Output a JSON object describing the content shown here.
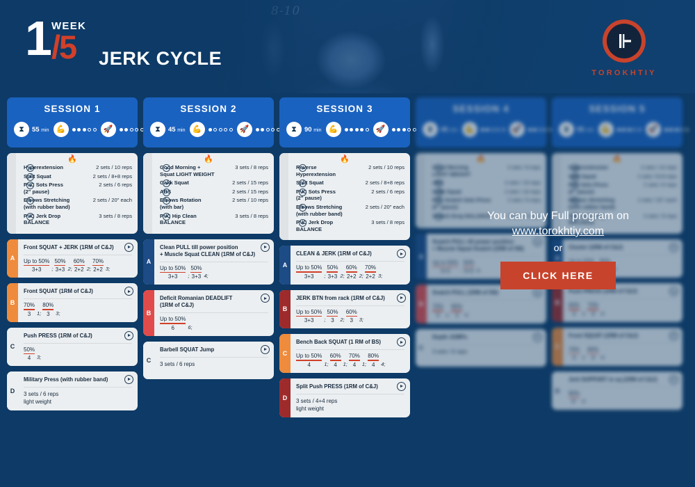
{
  "header": {
    "week_number": "1",
    "week_word": "WEEK",
    "week_fraction": "/5",
    "program_title": "JERK CYCLE",
    "chalk_text": "8-10",
    "brand_name": "TOROKHTIY",
    "logo_icon": "torokhtiy-barbell-logo"
  },
  "cta": {
    "line1": "You can buy Full program on",
    "link": "www.torokhtiy.com",
    "or": "or",
    "button": "CLICK HERE",
    "accent": "#c8432c"
  },
  "colors": {
    "background": "#0d3a66",
    "session_header": "#1a62c0",
    "card": "#eceff1",
    "accent_red": "#d1402a",
    "letter_orange": "#ef8b3c",
    "letter_red": "#e24b4b",
    "letter_darkred": "#9e2b2b",
    "letter_navy": "#1c4b86"
  },
  "icons": {
    "time": "hourglass-icon",
    "intensity": "muscle-arm-icon",
    "effort": "rocket-icon",
    "flame": "flame-icon",
    "play": "play-icon"
  },
  "sessions": [
    {
      "title": "SESSION 1",
      "locked": false,
      "duration": "55",
      "duration_unit": "min",
      "intensity": 3,
      "intensity_max": 5,
      "effort": 2,
      "effort_max": 5,
      "warmup": [
        {
          "name": "Hyperextension",
          "volume": "2 sets / 10 reps"
        },
        {
          "name": "Split Squat",
          "volume": "2 sets / 8+8 reps"
        },
        {
          "name": "PVC Sots Press\n(2\" pause)",
          "volume": "2 sets / 6 reps"
        },
        {
          "name": "Elbows Stretching\n(with rubber band)",
          "volume": "2 sets / 20\" each"
        },
        {
          "name": "PVC Jerk Drop\nBALANCE",
          "volume": "3 sets / 8 reps"
        }
      ],
      "blocks": [
        {
          "letter": "A",
          "letter_color": "orange",
          "title": "Front SQUAT + JERK (1RM of C&J)",
          "sets": [
            {
              "top": "Up to 50%",
              "bot": "3+3",
              "mult": ";"
            },
            {
              "top": "50%",
              "bot": "3+3",
              "mult": "2;"
            },
            {
              "top": "60%",
              "bot": "2+2",
              "mult": "2;"
            },
            {
              "top": "70%",
              "bot": "2+2",
              "mult": "3;"
            }
          ]
        },
        {
          "letter": "B",
          "letter_color": "orange",
          "title": "Front SQUAT (1RM of C&J)",
          "sets": [
            {
              "top": "70%",
              "bot": "3",
              "mult": "1;"
            },
            {
              "top": "80%",
              "bot": "3",
              "mult": "3;"
            }
          ]
        },
        {
          "letter": "C",
          "letter_color": "plain",
          "title": "Push PRESS (1RM of C&J)",
          "sets": [
            {
              "top": "50%",
              "bot": "4",
              "mult": "3;"
            }
          ]
        },
        {
          "letter": "D",
          "letter_color": "plain",
          "title": "Military Press (with rubber band)",
          "text": "3 sets / 6 reps\nlight weight"
        }
      ]
    },
    {
      "title": "SESSION 2",
      "locked": false,
      "duration": "45",
      "duration_unit": "min",
      "intensity": 1,
      "intensity_max": 5,
      "effort": 2,
      "effort_max": 5,
      "warmup": [
        {
          "name": "Good Morning +\nSquat LIGHT WEIGHT",
          "volume": "3 sets / 8 reps"
        },
        {
          "name": "Gakk Squat",
          "volume": "2 sets / 15 reps"
        },
        {
          "name": "ABS",
          "volume": "2 sets / 15 reps"
        },
        {
          "name": "Elbows Rotation\n(with bar)",
          "volume": "2 sets / 10 reps"
        },
        {
          "name": "PVC Hip Clean\nBALANCE",
          "volume": "3 sets / 8 reps"
        }
      ],
      "blocks": [
        {
          "letter": "A",
          "letter_color": "navy",
          "title": "Clean PULL till power position\n+ Muscle Squat CLEAN (1RM of C&J)",
          "sets": [
            {
              "top": "Up to 50%",
              "bot": "3+3",
              "mult": ";"
            },
            {
              "top": "50%",
              "bot": "3+3",
              "mult": "4;"
            }
          ]
        },
        {
          "letter": "B",
          "letter_color": "red",
          "title": "Deficit Romanian DEADLIFT\n(1RM of C&J)",
          "sets": [
            {
              "top": "Up to 50%",
              "bot": "6",
              "mult": "6;"
            }
          ]
        },
        {
          "letter": "C",
          "letter_color": "plain",
          "title": "Barbell SQUAT Jump",
          "text": "3 sets / 6 reps"
        }
      ]
    },
    {
      "title": "SESSION 3",
      "locked": false,
      "duration": "90",
      "duration_unit": "min",
      "intensity": 4,
      "intensity_max": 5,
      "effort": 3,
      "effort_max": 5,
      "warmup": [
        {
          "name": "Reverse\nHyperextension",
          "volume": "2 sets / 10 reps"
        },
        {
          "name": "Split Squat",
          "volume": "2 sets / 8+8 reps"
        },
        {
          "name": "PVC Sots Press\n(2\" pause)",
          "volume": "2 sets / 6 reps"
        },
        {
          "name": "Elbows Stretching\n(with rubber band)",
          "volume": "2 sets / 20\" each"
        },
        {
          "name": "PVC Jerk Drop\nBALANCE",
          "volume": "3 sets / 8 reps"
        }
      ],
      "blocks": [
        {
          "letter": "A",
          "letter_color": "navy",
          "title": "CLEAN & JERK (1RM of C&J)",
          "sets": [
            {
              "top": "Up to 50%",
              "bot": "3+3",
              "mult": ";"
            },
            {
              "top": "50%",
              "bot": "3+3",
              "mult": "2;"
            },
            {
              "top": "60%",
              "bot": "2+2",
              "mult": "2;"
            },
            {
              "top": "70%",
              "bot": "2+2",
              "mult": "3;"
            }
          ]
        },
        {
          "letter": "B",
          "letter_color": "darkred",
          "title": "JERK BTN from rack (1RM of C&J)",
          "sets": [
            {
              "top": "Up to 50%",
              "bot": "3+3",
              "mult": ";"
            },
            {
              "top": "50%",
              "bot": "3",
              "mult": "2;"
            },
            {
              "top": "60%",
              "bot": "3",
              "mult": "3;"
            }
          ]
        },
        {
          "letter": "C",
          "letter_color": "orange",
          "title": "Bench Back SQUAT (1 RM of BS)",
          "sets": [
            {
              "top": "Up to 50%",
              "bot": "4",
              "mult": "1;"
            },
            {
              "top": "60%",
              "bot": "4",
              "mult": "1;"
            },
            {
              "top": "70%",
              "bot": "4",
              "mult": "1;"
            },
            {
              "top": "80%",
              "bot": "4",
              "mult": "4;"
            }
          ]
        },
        {
          "letter": "D",
          "letter_color": "darkred",
          "title": "Split Push PRESS (1RM of C&J)",
          "text": "3 sets / 4+4 reps\nlight weight"
        }
      ]
    },
    {
      "title": "SESSION 4",
      "locked": true,
      "duration": "45",
      "duration_unit": "min",
      "intensity": 2,
      "intensity_max": 5,
      "effort": 2,
      "effort_max": 5,
      "warmup": [
        {
          "name": "Good Morning\nLIGHT WEIGHT",
          "volume": "3 sets / 8 reps"
        },
        {
          "name": "ABS",
          "volume": "2 sets / 15 reps"
        },
        {
          "name": "Gakk Squat",
          "volume": "2 sets / 15 reps"
        },
        {
          "name": "PVC Snatch Sots Press\n(2\" pause)",
          "volume": "2 sets / 6 reps"
        },
        {
          "name": "Snatch Drop BALANCE",
          "volume": "3 sets / 8 reps"
        }
      ],
      "blocks": [
        {
          "letter": "A",
          "letter_color": "navy",
          "title": "Snatch PULL till power position\n+ Muscle Squat Snatch (1RM of SN)",
          "sets": [
            {
              "top": "Up to 50%",
              "bot": "3+3",
              "mult": ";"
            },
            {
              "top": "50%",
              "bot": "3+3",
              "mult": "4;"
            }
          ]
        },
        {
          "letter": "B",
          "letter_color": "red",
          "title": "Snatch PULL (1RM of SN)",
          "sets": [
            {
              "top": "70%",
              "bot": "4",
              "mult": "1;"
            },
            {
              "top": "80%",
              "bot": "3",
              "mult": "4;"
            }
          ]
        },
        {
          "letter": "C",
          "letter_color": "plain",
          "title": "Depth JUMPs",
          "text": "3 sets / 6 reps"
        }
      ]
    },
    {
      "title": "SESSION 5",
      "locked": true,
      "duration": "55",
      "duration_unit": "min",
      "intensity": 3,
      "intensity_max": 5,
      "effort": 3,
      "effort_max": 5,
      "warmup": [
        {
          "name": "Hyperextension",
          "volume": "2 sets / 10 reps"
        },
        {
          "name": "Split Squat",
          "volume": "2 sets / 8+8 reps"
        },
        {
          "name": "PVC Sots Press\n(2\" pause)",
          "volume": "2 sets / 6 reps"
        },
        {
          "name": "Elbows Stretching\n(with rubber band)",
          "volume": "2 sets / 20\" each"
        },
        {
          "name": "PVC Jerk Drop\nBALANCE",
          "volume": "3 sets / 8 reps"
        }
      ],
      "blocks": [
        {
          "letter": "A",
          "letter_color": "navy",
          "title": "Cluster (1RM of C&J)",
          "sets": [
            {
              "top": "Up to 50%",
              "bot": "3+3",
              "mult": ";"
            },
            {
              "top": "60%",
              "bot": "2+2",
              "mult": "4;"
            }
          ]
        },
        {
          "letter": "B",
          "letter_color": "darkred",
          "title": "Push PRESS (1RM of C&J)",
          "sets": [
            {
              "top": "60%",
              "bot": "4",
              "mult": "1;"
            },
            {
              "top": "70%",
              "bot": "4",
              "mult": "4;"
            }
          ]
        },
        {
          "letter": "C",
          "letter_color": "orange",
          "title": "Front SQUAT (1RM of C&J)",
          "sets": [
            {
              "top": "70%",
              "bot": "4",
              "mult": "1;"
            },
            {
              "top": "80%",
              "bot": "4",
              "mult": "4;"
            }
          ]
        },
        {
          "letter": "D",
          "letter_color": "plain",
          "title": "Jerk SUPPORT in sq (1RM of C&J)",
          "sets": [
            {
              "top": "90%",
              "bot": "5\"",
              "mult": "4;"
            }
          ]
        }
      ]
    }
  ]
}
